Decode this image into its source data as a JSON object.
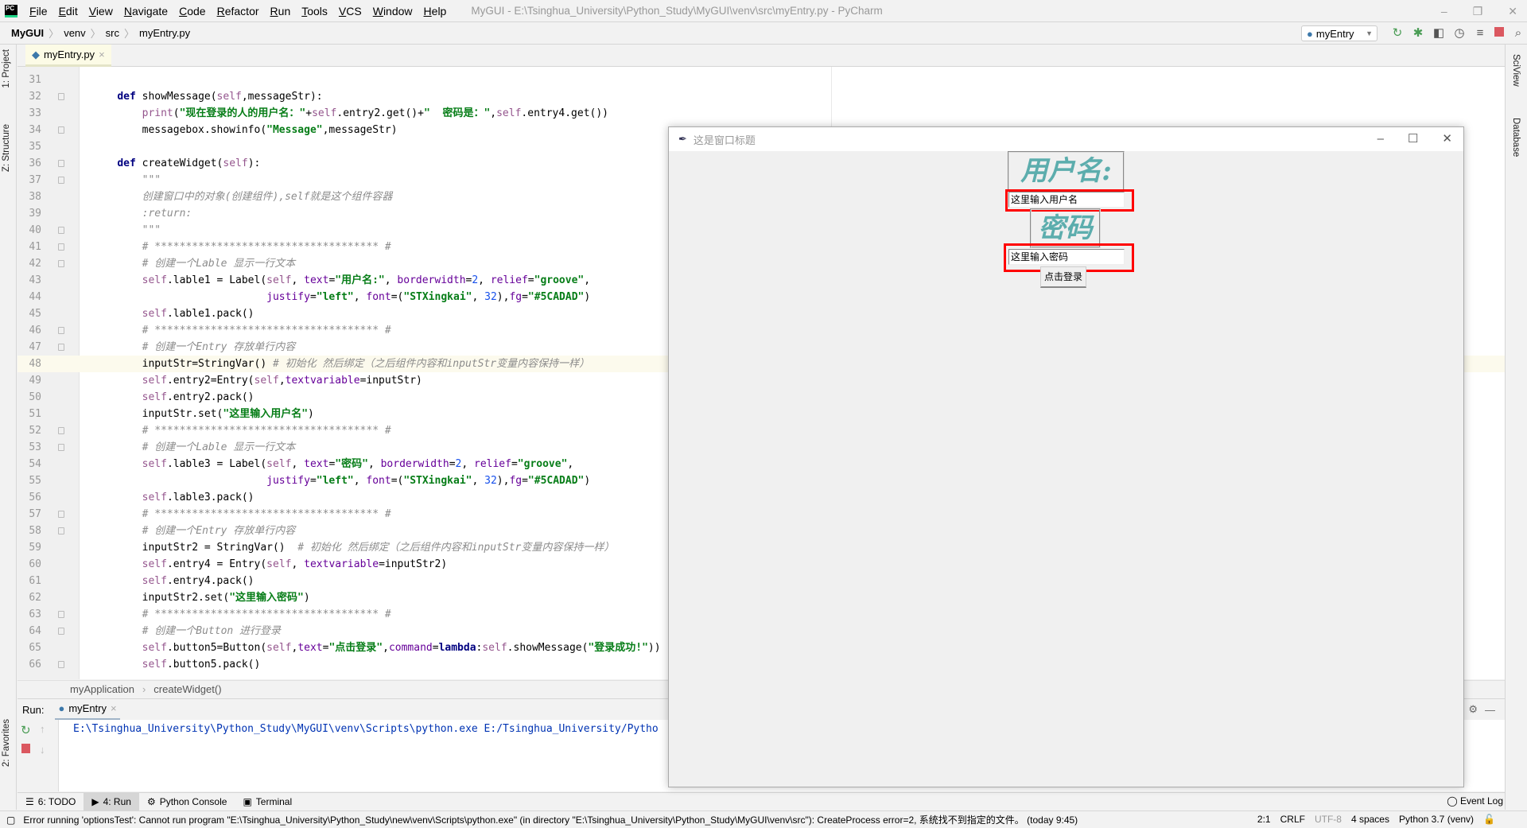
{
  "app": {
    "title": "MyGUI - E:\\Tsinghua_University\\Python_Study\\MyGUI\\venv\\src\\myEntry.py - PyCharm",
    "logo": "PC"
  },
  "menu": [
    "File",
    "Edit",
    "View",
    "Navigate",
    "Code",
    "Refactor",
    "Run",
    "Tools",
    "VCS",
    "Window",
    "Help"
  ],
  "window_controls": {
    "minimize": "–",
    "maximize": "❐",
    "close": "✕"
  },
  "breadcrumb": [
    "MyGUI",
    "venv",
    "src",
    "myEntry.py"
  ],
  "toolbar": {
    "run_config": "myEntry",
    "icons": [
      "rerun-icon",
      "debug-icon",
      "coverage-icon",
      "profile-icon",
      "concurrency-icon",
      "stop-icon",
      "search-icon"
    ]
  },
  "left_tabs": [
    "1: Project",
    "Z: Structure",
    "2: Favorites"
  ],
  "right_tabs": [
    "SciView",
    "Database"
  ],
  "editor_tab": {
    "label": "myEntry.py",
    "close": "×"
  },
  "editor": {
    "current_line": 48,
    "lines": [
      {
        "n": 31,
        "f": false,
        "t": []
      },
      {
        "n": 32,
        "f": true,
        "t": [
          [
            "t",
            "    "
          ],
          [
            "k",
            "def "
          ],
          [
            "t",
            "showMessage("
          ],
          [
            "s",
            "self"
          ],
          [
            "t",
            ",messageStr):"
          ]
        ]
      },
      {
        "n": 33,
        "f": false,
        "t": [
          [
            "t",
            "        "
          ],
          [
            "s",
            "print"
          ],
          [
            "t",
            "("
          ],
          [
            "str",
            "\"现在登录的人的用户名：\""
          ],
          [
            "t",
            "+"
          ],
          [
            "s",
            "self"
          ],
          [
            "t",
            ".entry2.get()+"
          ],
          [
            "str",
            "\"  密码是：\""
          ],
          [
            "t",
            ","
          ],
          [
            "s",
            "self"
          ],
          [
            "t",
            ".entry4.get())"
          ]
        ]
      },
      {
        "n": 34,
        "f": true,
        "t": [
          [
            "t",
            "        messagebox.showinfo("
          ],
          [
            "str",
            "\"Message\""
          ],
          [
            "t",
            ",messageStr)"
          ]
        ]
      },
      {
        "n": 35,
        "f": false,
        "t": []
      },
      {
        "n": 36,
        "f": true,
        "t": [
          [
            "t",
            "    "
          ],
          [
            "k",
            "def "
          ],
          [
            "t",
            "createWidget("
          ],
          [
            "s",
            "self"
          ],
          [
            "t",
            "):"
          ]
        ]
      },
      {
        "n": 37,
        "f": true,
        "t": [
          [
            "d",
            "        \"\"\""
          ]
        ]
      },
      {
        "n": 38,
        "f": false,
        "t": [
          [
            "d",
            "        创建窗口中的对象(创建组件),self就是这个组件容器"
          ]
        ]
      },
      {
        "n": 39,
        "f": false,
        "t": [
          [
            "d",
            "        :return:"
          ]
        ]
      },
      {
        "n": 40,
        "f": true,
        "t": [
          [
            "d",
            "        \"\"\""
          ]
        ]
      },
      {
        "n": 41,
        "f": true,
        "t": [
          [
            "c",
            "        # ************************************ #"
          ]
        ]
      },
      {
        "n": 42,
        "f": true,
        "t": [
          [
            "c",
            "        # 创建一个Lable 显示一行文本"
          ]
        ]
      },
      {
        "n": 43,
        "f": false,
        "t": [
          [
            "t",
            "        "
          ],
          [
            "s",
            "self"
          ],
          [
            "t",
            ".lable1 = Label("
          ],
          [
            "s",
            "self"
          ],
          [
            "t",
            ", "
          ],
          [
            "p",
            "text"
          ],
          [
            "t",
            "="
          ],
          [
            "str",
            "\"用户名:\""
          ],
          [
            "t",
            ", "
          ],
          [
            "p",
            "borderwidth"
          ],
          [
            "t",
            "="
          ],
          [
            "n",
            "2"
          ],
          [
            "t",
            ", "
          ],
          [
            "p",
            "relief"
          ],
          [
            "t",
            "="
          ],
          [
            "str",
            "\"groove\""
          ],
          [
            "t",
            ","
          ]
        ]
      },
      {
        "n": 44,
        "f": false,
        "t": [
          [
            "t",
            "                            "
          ],
          [
            "p",
            "justify"
          ],
          [
            "t",
            "="
          ],
          [
            "str",
            "\"left\""
          ],
          [
            "t",
            ", "
          ],
          [
            "p",
            "font"
          ],
          [
            "t",
            "=("
          ],
          [
            "str",
            "\"STXingkai\""
          ],
          [
            "t",
            ", "
          ],
          [
            "n",
            "32"
          ],
          [
            "t",
            "),"
          ],
          [
            "p",
            "fg"
          ],
          [
            "t",
            "="
          ],
          [
            "str",
            "\"#5CADAD\""
          ],
          [
            "t",
            ")"
          ]
        ]
      },
      {
        "n": 45,
        "f": false,
        "t": [
          [
            "t",
            "        "
          ],
          [
            "s",
            "self"
          ],
          [
            "t",
            ".lable1.pack()"
          ]
        ]
      },
      {
        "n": 46,
        "f": true,
        "t": [
          [
            "c",
            "        # ************************************ #"
          ]
        ]
      },
      {
        "n": 47,
        "f": true,
        "t": [
          [
            "c",
            "        # 创建一个Entry 存放单行内容"
          ]
        ]
      },
      {
        "n": 48,
        "f": false,
        "t": [
          [
            "t",
            "        inputStr=StringVar() "
          ],
          [
            "c",
            "# 初始化 然后绑定（之后组件内容和inputStr变量内容保持一样）"
          ]
        ]
      },
      {
        "n": 49,
        "f": false,
        "t": [
          [
            "t",
            "        "
          ],
          [
            "s",
            "self"
          ],
          [
            "t",
            ".entry2=Entry("
          ],
          [
            "s",
            "self"
          ],
          [
            "t",
            ","
          ],
          [
            "p",
            "textvariable"
          ],
          [
            "t",
            "=inputStr)"
          ]
        ]
      },
      {
        "n": 50,
        "f": false,
        "t": [
          [
            "t",
            "        "
          ],
          [
            "s",
            "self"
          ],
          [
            "t",
            ".entry2.pack()"
          ]
        ]
      },
      {
        "n": 51,
        "f": false,
        "t": [
          [
            "t",
            "        inputStr.set("
          ],
          [
            "str",
            "\"这里输入用户名\""
          ],
          [
            "t",
            ")"
          ]
        ]
      },
      {
        "n": 52,
        "f": true,
        "t": [
          [
            "c",
            "        # ************************************ #"
          ]
        ]
      },
      {
        "n": 53,
        "f": true,
        "t": [
          [
            "c",
            "        # 创建一个Lable 显示一行文本"
          ]
        ]
      },
      {
        "n": 54,
        "f": false,
        "t": [
          [
            "t",
            "        "
          ],
          [
            "s",
            "self"
          ],
          [
            "t",
            ".lable3 = Label("
          ],
          [
            "s",
            "self"
          ],
          [
            "t",
            ", "
          ],
          [
            "p",
            "text"
          ],
          [
            "t",
            "="
          ],
          [
            "str",
            "\"密码\""
          ],
          [
            "t",
            ", "
          ],
          [
            "p",
            "borderwidth"
          ],
          [
            "t",
            "="
          ],
          [
            "n",
            "2"
          ],
          [
            "t",
            ", "
          ],
          [
            "p",
            "relief"
          ],
          [
            "t",
            "="
          ],
          [
            "str",
            "\"groove\""
          ],
          [
            "t",
            ","
          ]
        ]
      },
      {
        "n": 55,
        "f": false,
        "t": [
          [
            "t",
            "                            "
          ],
          [
            "p",
            "justify"
          ],
          [
            "t",
            "="
          ],
          [
            "str",
            "\"left\""
          ],
          [
            "t",
            ", "
          ],
          [
            "p",
            "font"
          ],
          [
            "t",
            "=("
          ],
          [
            "str",
            "\"STXingkai\""
          ],
          [
            "t",
            ", "
          ],
          [
            "n",
            "32"
          ],
          [
            "t",
            "),"
          ],
          [
            "p",
            "fg"
          ],
          [
            "t",
            "="
          ],
          [
            "str",
            "\"#5CADAD\""
          ],
          [
            "t",
            ")"
          ]
        ]
      },
      {
        "n": 56,
        "f": false,
        "t": [
          [
            "t",
            "        "
          ],
          [
            "s",
            "self"
          ],
          [
            "t",
            ".lable3.pack()"
          ]
        ]
      },
      {
        "n": 57,
        "f": true,
        "t": [
          [
            "c",
            "        # ************************************ #"
          ]
        ]
      },
      {
        "n": 58,
        "f": true,
        "t": [
          [
            "c",
            "        # 创建一个Entry 存放单行内容"
          ]
        ]
      },
      {
        "n": 59,
        "f": false,
        "t": [
          [
            "t",
            "        inputStr2 = StringVar()  "
          ],
          [
            "c",
            "# 初始化 然后绑定（之后组件内容和inputStr变量内容保持一样）"
          ]
        ]
      },
      {
        "n": 60,
        "f": false,
        "t": [
          [
            "t",
            "        "
          ],
          [
            "s",
            "self"
          ],
          [
            "t",
            ".entry4 = Entry("
          ],
          [
            "s",
            "self"
          ],
          [
            "t",
            ", "
          ],
          [
            "p",
            "textvariable"
          ],
          [
            "t",
            "=inputStr2)"
          ]
        ]
      },
      {
        "n": 61,
        "f": false,
        "t": [
          [
            "t",
            "        "
          ],
          [
            "s",
            "self"
          ],
          [
            "t",
            ".entry4.pack()"
          ]
        ]
      },
      {
        "n": 62,
        "f": false,
        "t": [
          [
            "t",
            "        inputStr2.set("
          ],
          [
            "str",
            "\"这里输入密码\""
          ],
          [
            "t",
            ")"
          ]
        ]
      },
      {
        "n": 63,
        "f": true,
        "t": [
          [
            "c",
            "        # ************************************ #"
          ]
        ]
      },
      {
        "n": 64,
        "f": true,
        "t": [
          [
            "c",
            "        # 创建一个Button 进行登录"
          ]
        ]
      },
      {
        "n": 65,
        "f": false,
        "t": [
          [
            "t",
            "        "
          ],
          [
            "s",
            "self"
          ],
          [
            "t",
            ".button5=Button("
          ],
          [
            "s",
            "self"
          ],
          [
            "t",
            ","
          ],
          [
            "p",
            "text"
          ],
          [
            "t",
            "="
          ],
          [
            "str",
            "\"点击登录\""
          ],
          [
            "t",
            ","
          ],
          [
            "p",
            "command"
          ],
          [
            "t",
            "="
          ],
          [
            "k",
            "lambda"
          ],
          [
            "t",
            ":"
          ],
          [
            "s",
            "self"
          ],
          [
            "t",
            ".showMessage("
          ],
          [
            "str",
            "\"登录成功!\""
          ],
          [
            "t",
            "))"
          ]
        ]
      },
      {
        "n": 66,
        "f": true,
        "t": [
          [
            "t",
            "        "
          ],
          [
            "s",
            "self"
          ],
          [
            "t",
            ".button5.pack()"
          ]
        ]
      }
    ]
  },
  "editor_breadcrumb": [
    "myApplication",
    "createWidget()"
  ],
  "run": {
    "label": "Run:",
    "tab": "myEntry",
    "console": "E:\\Tsinghua_University\\Python_Study\\MyGUI\\venv\\Scripts\\python.exe E:/Tsinghua_University/Pytho"
  },
  "tool_windows": [
    {
      "label": "6: TODO",
      "icon": "☰"
    },
    {
      "label": "4: Run",
      "icon": "▶",
      "active": true
    },
    {
      "label": "Python Console",
      "icon": "⚙"
    },
    {
      "label": "Terminal",
      "icon": "▣"
    }
  ],
  "event_log": "Event Log",
  "status": {
    "message": "Error running 'optionsTest': Cannot run program \"E:\\Tsinghua_University\\Python_Study\\new\\venv\\Scripts\\python.exe\" (in directory \"E:\\Tsinghua_University\\Python_Study\\MyGUI\\venv\\src\"): CreateProcess error=2, 系统找不到指定的文件。 (today 9:45)",
    "position": "2:1",
    "line_sep": "CRLF",
    "encoding": "UTF-8",
    "indent": "4 spaces",
    "interpreter": "Python 3.7 (venv)"
  },
  "tk_window": {
    "title": "这是窗口标题",
    "label1": "用户名:",
    "entry1": "这里输入用户名",
    "label2": "密码",
    "entry2": "这里输入密码",
    "button": "点击登录",
    "label_color": "#5CADAD",
    "highlight_color": "#FF0000"
  }
}
